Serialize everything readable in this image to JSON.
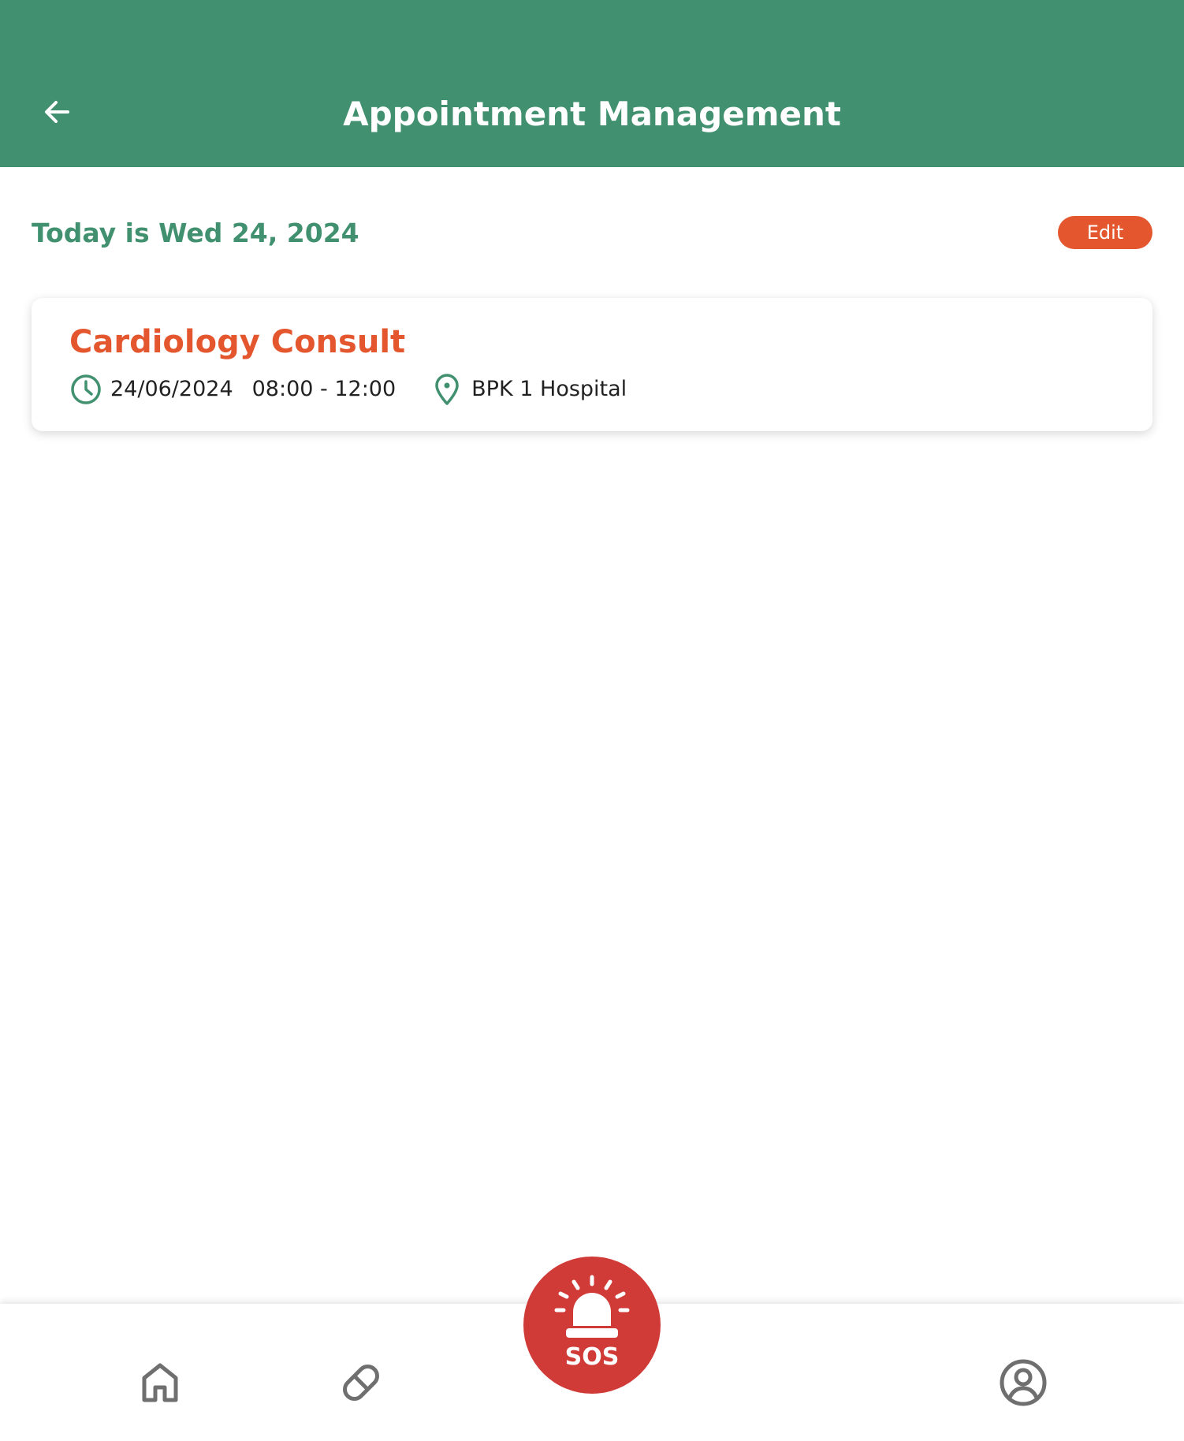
{
  "header": {
    "title": "Appointment Management",
    "back_icon": "arrow-left-icon",
    "background": "#41906f"
  },
  "date_row": {
    "today_label": "Today is Wed 24, 2024",
    "edit_label": "Edit"
  },
  "appointment": {
    "title": "Cardiology Consult",
    "date": "24/06/2024",
    "time": "08:00 - 12:00",
    "location": "BPK 1 Hospital",
    "time_icon": "clock-icon",
    "location_icon": "map-pin-icon"
  },
  "bottom_nav": {
    "items": [
      {
        "icon": "home-icon"
      },
      {
        "icon": "pill-icon"
      },
      {
        "icon": "profile-icon"
      }
    ],
    "sos_label": "SOS",
    "sos_icon": "siren-icon"
  },
  "colors": {
    "primary_green": "#41906f",
    "accent_orange": "#e4572e",
    "sos_red": "#d03a37",
    "nav_gray": "#6f6f6f"
  }
}
